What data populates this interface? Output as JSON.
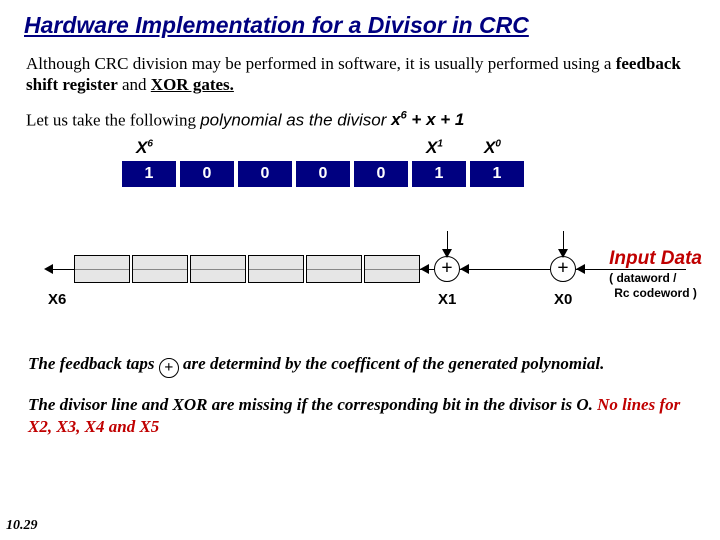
{
  "title": "Hardware Implementation for a Divisor in CRC",
  "para1_a": "Although CRC division may be performed in software, it is usually performed using a ",
  "para1_b": "feedback shift register",
  "para1_c": " and ",
  "para1_d": "XOR gates.",
  "para2_a": "Let us take the following ",
  "para2_b": "polynomial",
  "para2_c": " as the ",
  "para2_d": "divisor ",
  "poly_x": "x",
  "poly_p1": "6",
  "poly_plus": " + ",
  "poly_p2": "x + 1",
  "xlabels": {
    "x6": "X",
    "s6": "6",
    "x1": "X",
    "s1": "1",
    "x0": "X",
    "s0": "0"
  },
  "bits": [
    "1",
    "0",
    "0",
    "0",
    "0",
    "1",
    "1"
  ],
  "input_label": "Input Data",
  "input_sub1": "( dataword /",
  "input_sub2": "Rc codeword )",
  "xor_sym": "+",
  "axis": {
    "x6": "X6",
    "x1": "X1",
    "x0": "X0"
  },
  "para3_a": "The feedback taps ",
  "para3_b": " are determind by the coefficent of the generated polynomial.",
  "para4_a": "The divisor line and XOR are missing if the corresponding bit in the divisor is O. ",
  "para4_b": "No lines for X2, X3, X4 and X5",
  "pagenum": "10.29"
}
